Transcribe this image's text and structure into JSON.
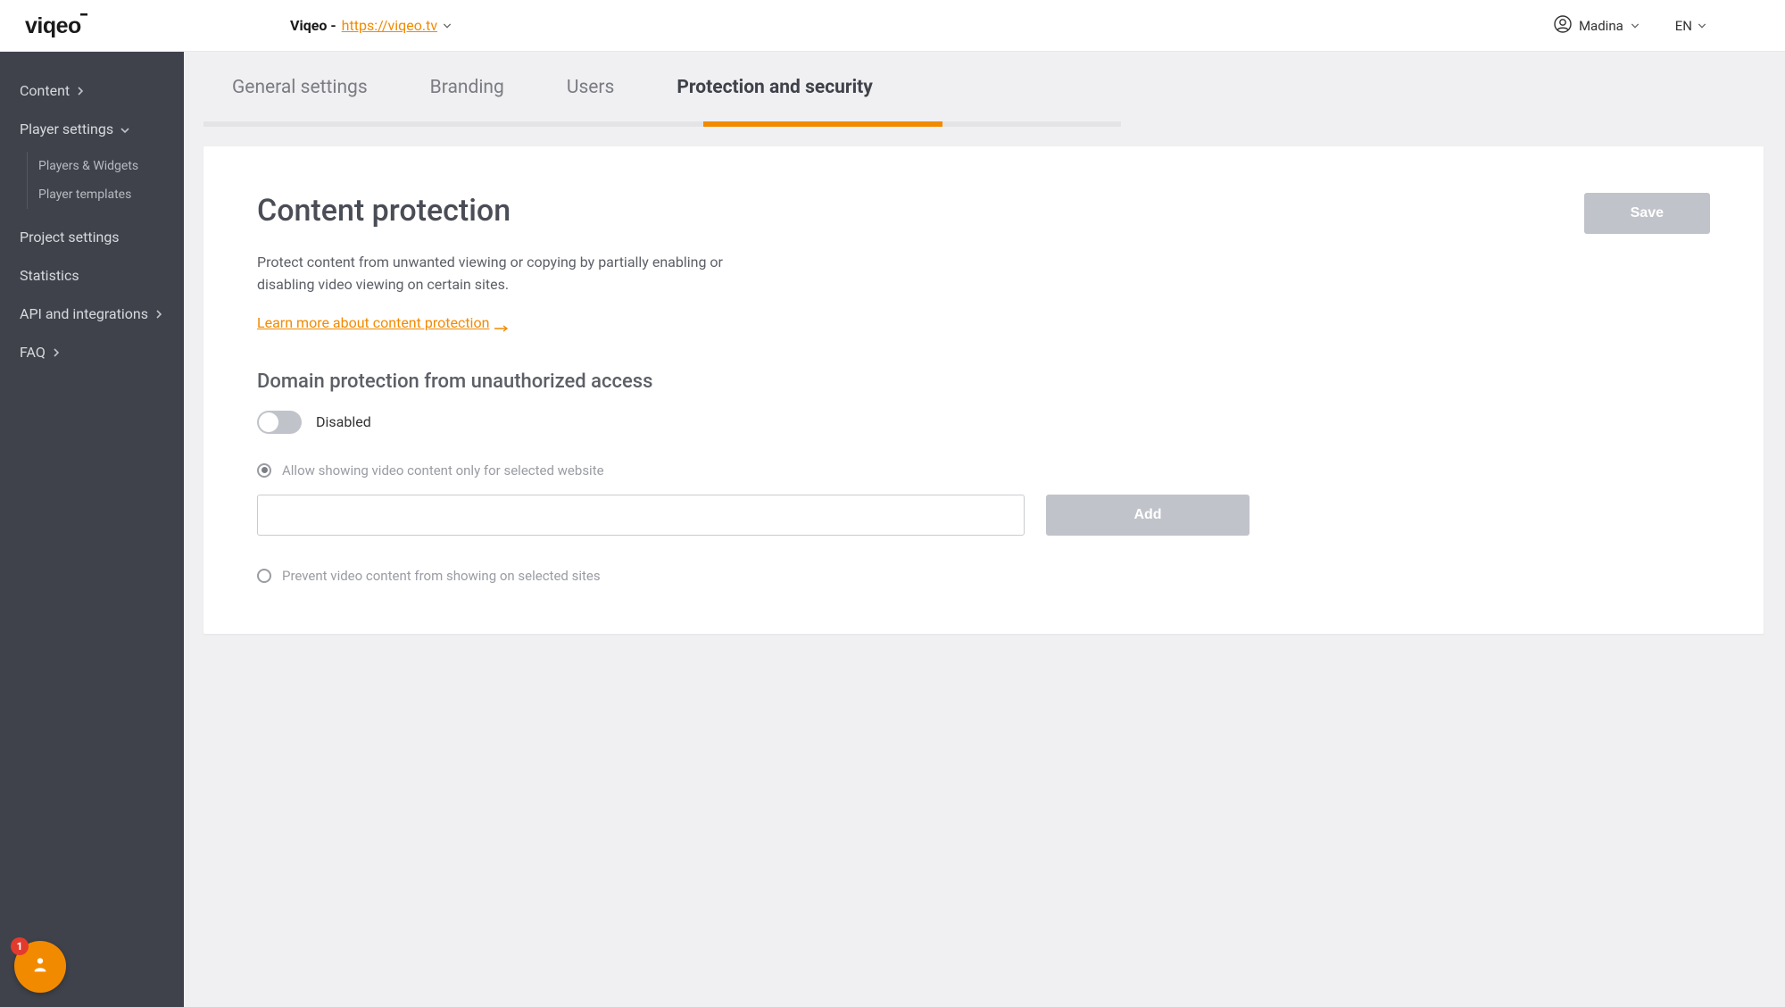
{
  "brand": {
    "logo": "viqeo"
  },
  "topbar": {
    "project_prefix": "Viqeo - ",
    "project_url": "https://viqeo.tv",
    "user_name": "Madina",
    "lang": "EN"
  },
  "sidebar": {
    "items": [
      {
        "label": "Content",
        "chevron": "right"
      },
      {
        "label": "Player settings",
        "chevron": "down"
      },
      {
        "label": "Project settings"
      },
      {
        "label": "Statistics"
      },
      {
        "label": "API and integrations",
        "chevron": "right"
      },
      {
        "label": "FAQ",
        "chevron": "right"
      }
    ],
    "sub_items": [
      {
        "label": "Players & Widgets"
      },
      {
        "label": "Player templates"
      }
    ]
  },
  "tabs": [
    {
      "label": "General settings"
    },
    {
      "label": "Branding"
    },
    {
      "label": "Users"
    },
    {
      "label": "Protection and security",
      "active": true
    }
  ],
  "card": {
    "title": "Content protection",
    "save_label": "Save",
    "description": "Protect content from unwanted viewing or copying by partially enabling or disabling video viewing on certain sites.",
    "learn_more": "Learn more about content protection",
    "section_heading": "Domain protection from unauthorized access",
    "toggle_state": "Disabled",
    "radio_allow": "Allow showing video content only for selected website",
    "add_label": "Add",
    "domain_input_value": "",
    "radio_prevent": "Prevent video content from showing on selected sites"
  },
  "chat": {
    "badge_count": "1"
  },
  "colors": {
    "accent": "#f28a00",
    "sidebar_bg": "#3f424a",
    "disabled": "#c1c3ca"
  }
}
